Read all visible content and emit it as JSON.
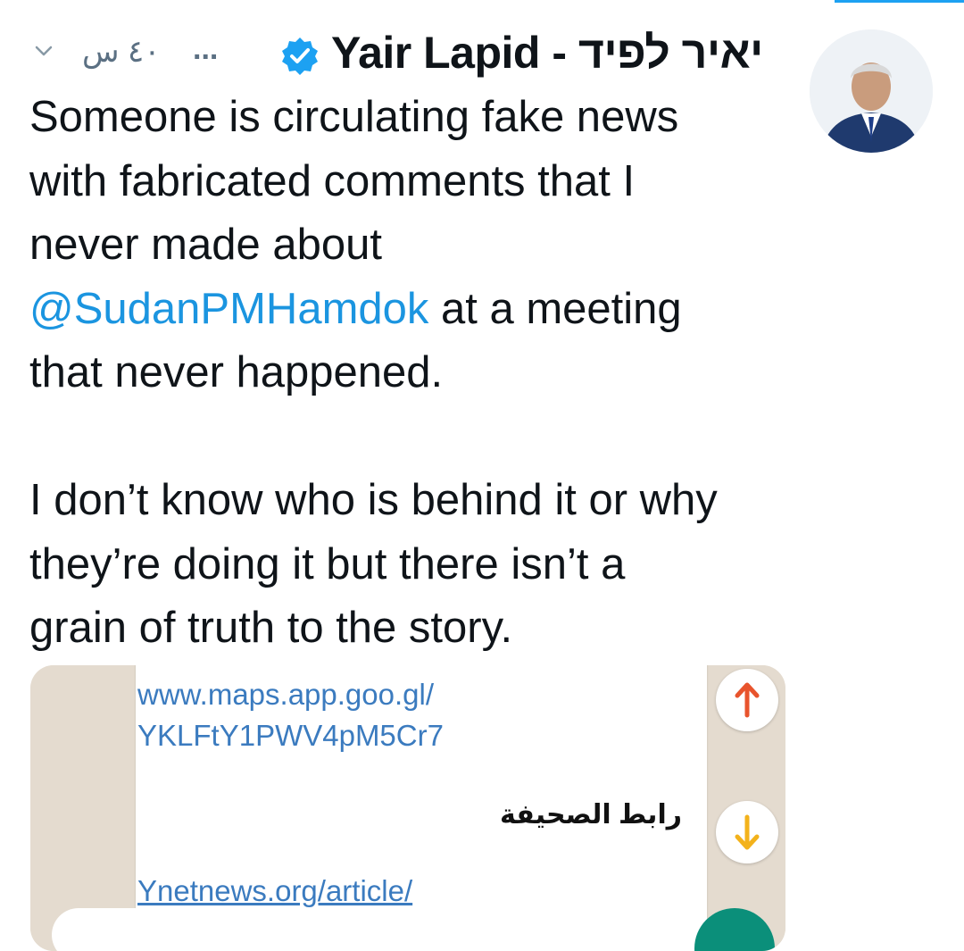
{
  "tweet": {
    "author_name": "Yair Lapid - יאיר לפיד",
    "time": "٤٠ س",
    "ellipsis": "...",
    "text_lines": [
      "Someone is circulating fake news",
      "with fabricated comments that I",
      "never made about"
    ],
    "mention": "@SudanPMHamdok",
    "mention_suffix": " at a meeting",
    "line_after_mention": "that never happened.",
    "paragraph2_lines": [
      "I don’t know who is behind it or why",
      "they’re doing it but there isn’t a",
      "grain of truth to the story."
    ]
  },
  "media": {
    "link_line1": "www.maps.app.goo.gl/",
    "link_line2": "YKLFtY1PWV4pM5Cr7",
    "arabic_label": "رابط الصحيفة",
    "link_bottom": "Ynetnews.org/article/"
  },
  "icons": {
    "verified": "verified-badge-icon",
    "chevron": "chevron-down-icon",
    "arrow_up": "arrow-up-icon",
    "arrow_down": "arrow-down-icon"
  },
  "colors": {
    "accent": "#1da1f2",
    "mention": "#1b95e0",
    "muted": "#5b7083",
    "link": "#3b7bbf",
    "arrow_up": "#e8542d",
    "arrow_down": "#f3b21b"
  }
}
